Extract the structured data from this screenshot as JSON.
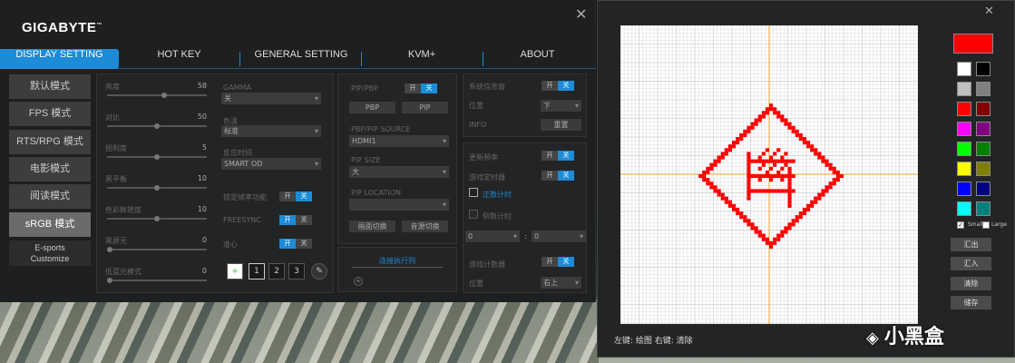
{
  "brand": {
    "logo": "GIGABYTE",
    "tm": "™"
  },
  "tabs": [
    "DISPLAY SETTING",
    "HOT KEY",
    "GENERAL SETTING",
    "KVM+",
    "ABOUT"
  ],
  "modes": [
    "默认模式",
    "FPS 模式",
    "RTS/RPG 模式",
    "电影模式",
    "阅读模式",
    "sRGB 模式"
  ],
  "mode_esports": [
    "E-sports",
    "Customize"
  ],
  "sliders": [
    {
      "label": "亮度",
      "value": "58",
      "fraction": 0.58
    },
    {
      "label": "对比",
      "value": "50",
      "fraction": 0.5
    },
    {
      "label": "锐利度",
      "value": "5",
      "fraction": 0.5
    },
    {
      "label": "黑平衡",
      "value": "10",
      "fraction": 0.5
    },
    {
      "label": "色彩鲜艳度",
      "value": "10",
      "fraction": 0.5
    },
    {
      "label": "黑屏无",
      "value": "0",
      "fraction": 0.0
    },
    {
      "label": "低蓝光模式",
      "value": "0",
      "fraction": 0.0
    }
  ],
  "pic": {
    "gamma_label": "GAMMA",
    "gamma_value": "关",
    "color_temp_label": "色温",
    "color_temp_value": "标准",
    "od_label": "反应时间",
    "od_value": "SMART OD",
    "lock_label": "锁定帧率功能",
    "freesync_label": "FREESYNC",
    "crosshair_label": "准心"
  },
  "toggle": {
    "on": "开",
    "off": "关"
  },
  "numbers": [
    "1",
    "2",
    "3"
  ],
  "pip": {
    "title": "PIP/PBP",
    "pbp": "PBP",
    "pip": "PIP",
    "source_label": "PBP/PIP SOURCE",
    "source_value": "HDMI1",
    "size_label": "PIP SIZE",
    "size_value": "大",
    "location_label": "PIP LOCATION",
    "location_value": "",
    "swap": "画面切换",
    "audio": "音源切换",
    "shortcut": "连接执行列"
  },
  "sys": {
    "info_label": "系统信息窗",
    "position_label": "位置",
    "position_value": "下",
    "info": "INFO",
    "reset": "重置"
  },
  "timer": {
    "refresh_label": "更新频率",
    "countdown_label": "游戏定时器",
    "count_down": "正数计时",
    "count_up": "倒数计时",
    "hour": "0",
    "minute": "0",
    "sep": ":",
    "counter_label": "游戏计数器",
    "pos_label": "位置",
    "pos_value": "右上"
  },
  "editor": {
    "footer": "左键: 绘图  右键: 清除",
    "small": "Small",
    "large": "Large",
    "export": "汇出",
    "import": "汇入",
    "clear": "清除",
    "save": "储存"
  },
  "palette": {
    "selected": "#ff0000",
    "colors": [
      "#ffffff",
      "#000000",
      "#c0c0c0",
      "#808080",
      "#ff0000",
      "#800000",
      "#ff00ff",
      "#800080",
      "#00ff00",
      "#008000",
      "#ffff00",
      "#808000",
      "#0000ff",
      "#000080",
      "#00ffff",
      "#008080"
    ]
  },
  "watermark": "小黑盒"
}
